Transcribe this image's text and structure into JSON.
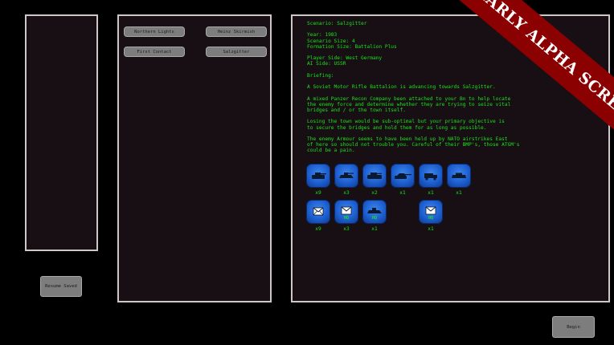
{
  "scenarios": {
    "northern_lights": "Northern Lights",
    "heinz_skirmish": "Heinz Skirmish",
    "first_contact": "First Contact",
    "salzgitter": "Salzgitter"
  },
  "buttons": {
    "resume_saved": "Resume Saved",
    "begin": "Begin"
  },
  "briefing": {
    "text": "Scenario: Salzgitter\n\nYear: 1983\nScenario Size: 4\nFormation Size: Battalion Plus\n\nPlayer Side: West Germany\nAI Side: USSR\n\nBriefing:\n\nA Soviet Motor Rifle Battalion is advancing towards Salzgitter.\n\nA mixed Panzer Recon Company been attached to your Bn to help locate\nthe enemy force and determine whether they are trying to seize vital\nbridges and / or the town itself.\n\nLosing the town would be sub-optimal but your primary objective is\nto secure the bridges and hold them for as long as possible.\n\nThe enemy Armour seems to have been held up by NATO airstrikes East\nof here so should not trouble you. Careful of their BMP's, those ATGM's\ncould be a pain."
  },
  "units_row1": [
    {
      "icon": "tank-icon",
      "count": "x9"
    },
    {
      "icon": "apc-icon",
      "count": "x3"
    },
    {
      "icon": "ifv-icon",
      "count": "x2"
    },
    {
      "icon": "tank-destroyer-icon",
      "count": "x1"
    },
    {
      "icon": "truck-icon",
      "count": "x1"
    },
    {
      "icon": "armored-car-icon",
      "count": "x1"
    }
  ],
  "units_row2": [
    {
      "icon": "envelope-icon",
      "count": "x9",
      "tag": ""
    },
    {
      "icon": "envelope-hq-icon",
      "count": "x3",
      "tag": "HQ"
    },
    {
      "icon": "apc-hq-icon",
      "count": "x1",
      "tag": "HQ"
    },
    {
      "icon": "envelope-hq-icon",
      "count": "x1",
      "tag": "HQ"
    }
  ],
  "banner": {
    "text": "EARLY ALPHA SCREEN",
    "color": "#8b0000"
  },
  "colors": {
    "terminal_text": "#19e319",
    "panel_bg": "#170f14",
    "unit_blue": "#1d5fd0"
  }
}
